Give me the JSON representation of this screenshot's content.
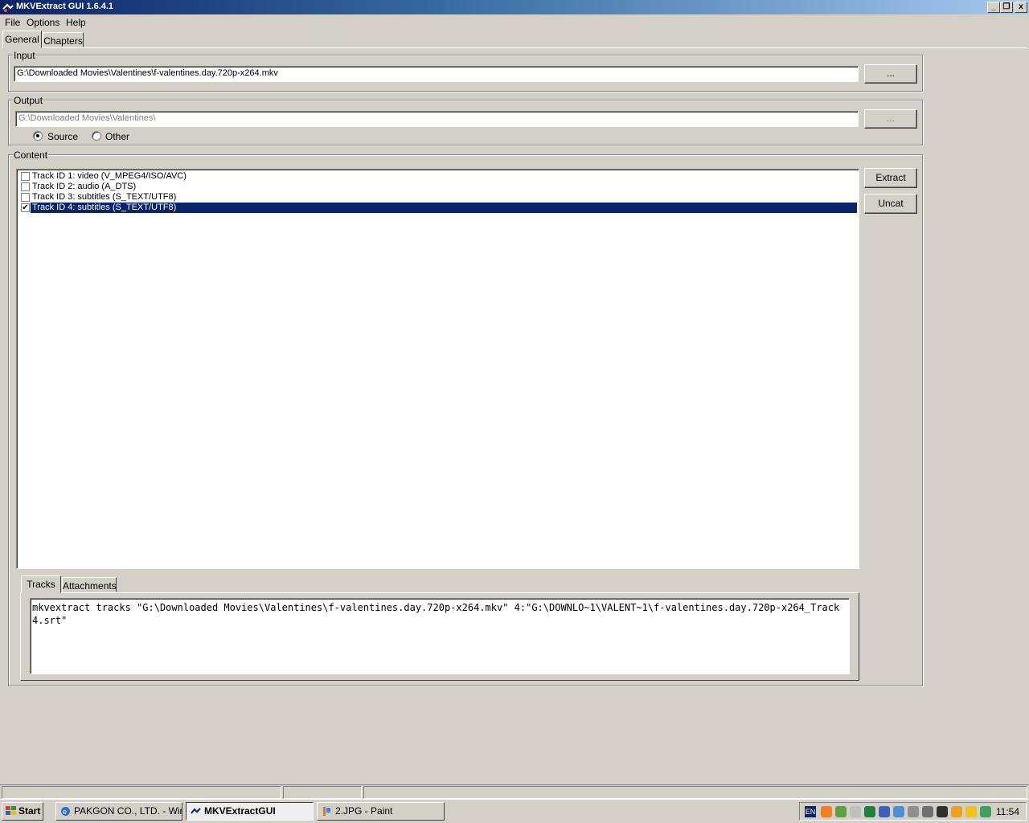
{
  "window": {
    "title": "MKVExtract GUI 1.6.4.1",
    "minimize": "_",
    "restore": "❐",
    "close": "x"
  },
  "menu": [
    {
      "label": "File"
    },
    {
      "label": "Options"
    },
    {
      "label": "Help"
    }
  ],
  "tabs": [
    {
      "label": "General",
      "active": true
    },
    {
      "label": "Chapters",
      "active": false
    }
  ],
  "input": {
    "label": "Input",
    "value": "G:\\Downloaded Movies\\Valentines\\f-valentines.day.720p-x264.mkv",
    "browse_label": "..."
  },
  "output": {
    "label": "Output",
    "value": "G:\\Downloaded Movies\\Valentines\\",
    "browse_label": "...",
    "radio_source": "Source",
    "radio_other": "Other",
    "selected": "Source"
  },
  "content": {
    "label": "Content",
    "tracks": [
      {
        "label": "Track ID 1: video (V_MPEG4/ISO/AVC)",
        "checked": false
      },
      {
        "label": "Track ID 2: audio (A_DTS)",
        "checked": false
      },
      {
        "label": "Track ID 3: subtitles (S_TEXT/UTF8)",
        "checked": false
      },
      {
        "label": "Track ID 4: subtitles (S_TEXT/UTF8)",
        "checked": true,
        "selected": true
      }
    ],
    "extract_label": "Extract",
    "uncat_label": "Uncat",
    "check_mark": "✔"
  },
  "subtabs": [
    {
      "label": "Tracks",
      "active": true
    },
    {
      "label": "Attachments",
      "active": false
    }
  ],
  "command": "mkvextract tracks \"G:\\Downloaded Movies\\Valentines\\f-valentines.day.720p-x264.mkv\" 4:\"G:\\DOWNLO~1\\VALENT~1\\f-valentines.day.720p-x264_Track4.srt\"",
  "taskbar": {
    "start_label": "Start",
    "tasks": [
      {
        "label": "PAKGON CO., LTD. - Win..."
      },
      {
        "label": "MKVExtractGUI",
        "active": true
      },
      {
        "label": "2.JPG - Paint"
      }
    ],
    "tray_lang": "EN",
    "clock": "11:54"
  },
  "colors": {
    "selection": "#0a246a",
    "face": "#d4d0c8"
  }
}
